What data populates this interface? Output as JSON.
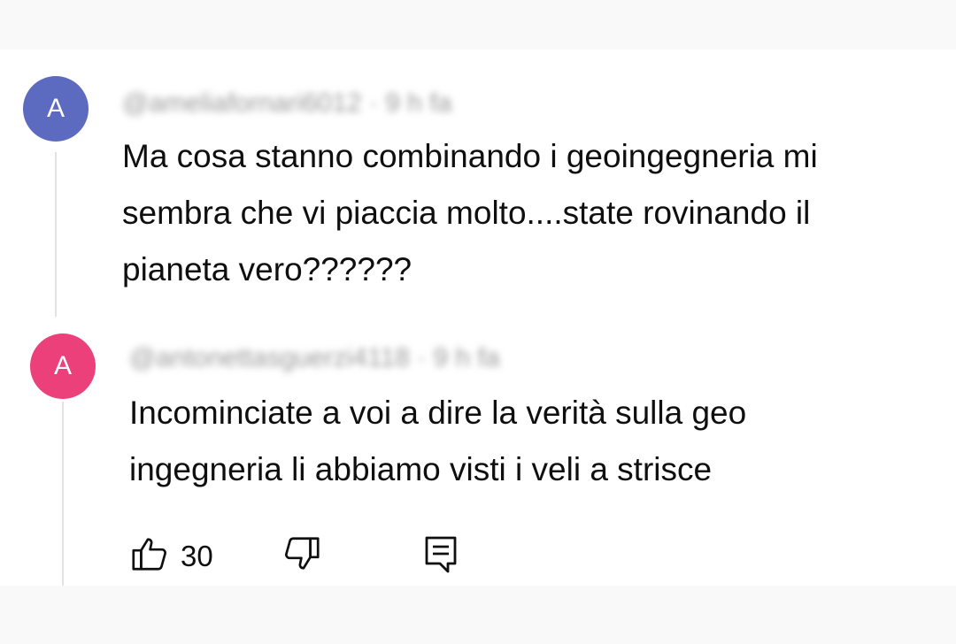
{
  "comments": [
    {
      "avatar_letter": "A",
      "avatar_color": "#5c6bc0",
      "handle": "@ameliafornari6012 · 9 h fa",
      "text_lines": [
        "Ma cosa stanno combinando i geoingegneria mi",
        "sembra che vi piaccia molto....state rovinando il",
        "pianeta vero??????"
      ]
    },
    {
      "avatar_letter": "A",
      "avatar_color": "#ec407a",
      "handle": "@antonettasguerzi4118 · 9 h fa",
      "text_lines": [
        "Incominciate a voi a dire la verità sulla geo",
        "ingegneria li abbiamo visti i veli a strisce"
      ]
    }
  ],
  "actions": {
    "like_icon": "thumb-up-icon",
    "like_count": "30",
    "dislike_icon": "thumb-down-icon",
    "reply_icon": "reply-comment-icon"
  }
}
